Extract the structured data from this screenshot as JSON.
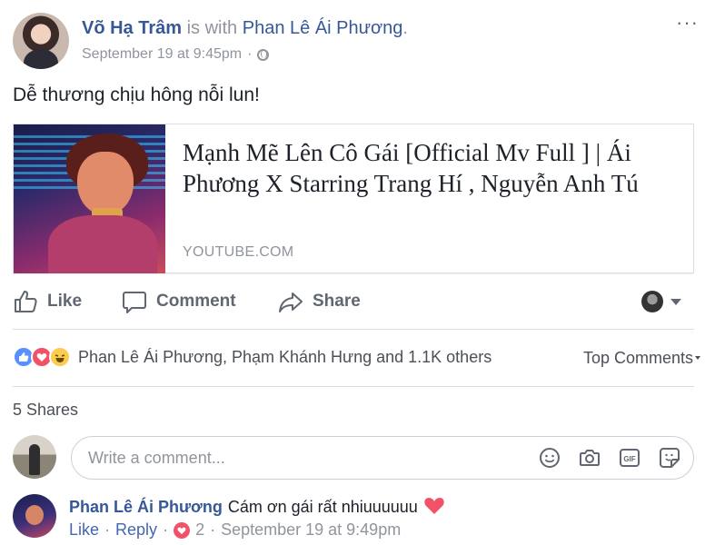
{
  "post": {
    "author": "Võ Hạ Trâm",
    "with_text": "is with",
    "tagged": "Phan Lê Ái Phương",
    "tagged_suffix": ".",
    "timestamp": "September 19 at 9:45pm",
    "meta_sep": "·",
    "privacy_icon": "globe-icon",
    "more_icon": "···",
    "text": "Dễ thương chịu hông nỗi lun!"
  },
  "link": {
    "title": "Mạnh Mẽ Lên Cô Gái [Official Mv Full ] | Ái Phương X Starring Trang Hí , Nguyễn Anh Tú",
    "domain": "YOUTUBE.COM"
  },
  "actions": {
    "like": "Like",
    "comment": "Comment",
    "share": "Share"
  },
  "reactions": {
    "names": "Phan Lê Ái Phương, Phạm Khánh Hưng and 1.1K others",
    "types": [
      "like-icon",
      "love-icon",
      "haha-icon"
    ],
    "top_comments": "Top Comments"
  },
  "shares": "5 Shares",
  "composer": {
    "placeholder": "Write a comment...",
    "icons": [
      "emoji-icon",
      "camera-icon",
      "gif-icon",
      "sticker-icon"
    ]
  },
  "comment": {
    "author": "Phan Lê Ái Phương",
    "text": "Cám ơn gái rất nhiuuuuuu",
    "like": "Like",
    "reply": "Reply",
    "sep": "·",
    "reaction_count": "2",
    "time": "September 19 at 9:49pm"
  },
  "colors": {
    "link_blue": "#365899",
    "meta_gray": "#90949c",
    "love_red": "#f25268",
    "like_blue": "#5890ff"
  }
}
